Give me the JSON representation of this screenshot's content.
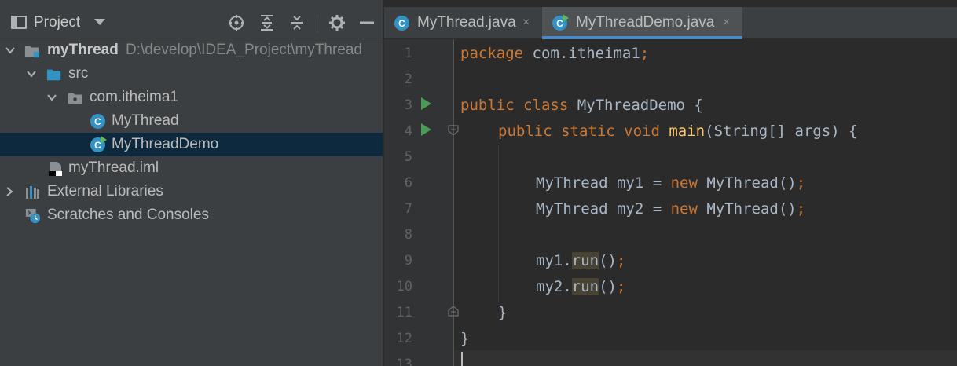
{
  "project_panel": {
    "title": "Project",
    "icons": [
      "locate-icon",
      "expand-all-icon",
      "collapse-all-icon",
      "gear-icon",
      "hide-icon"
    ],
    "tree": [
      {
        "label": "myThread",
        "path": "D:\\develop\\IDEA_Project\\myThread",
        "icon": "module-icon",
        "expanded": true
      },
      {
        "label": "src",
        "icon": "folder-icon",
        "expanded": true
      },
      {
        "label": "com.itheima1",
        "icon": "package-icon",
        "expanded": true
      },
      {
        "label": "MyThread",
        "icon": "class-icon"
      },
      {
        "label": "MyThreadDemo",
        "icon": "runnable-class-icon",
        "selected": true
      },
      {
        "label": "myThread.iml",
        "icon": "iml-file-icon"
      },
      {
        "label": "External Libraries",
        "icon": "libraries-icon",
        "expanded": false
      },
      {
        "label": "Scratches and Consoles",
        "icon": "scratches-icon"
      }
    ]
  },
  "tabs": [
    {
      "label": "MyThread.java",
      "close": "×",
      "active": false
    },
    {
      "label": "MyThreadDemo.java",
      "close": "×",
      "active": true
    }
  ],
  "editor": {
    "line_numbers": [
      "1",
      "2",
      "3",
      "4",
      "5",
      "6",
      "7",
      "8",
      "9",
      "10",
      "11",
      "12",
      "13"
    ],
    "lines": {
      "l1_kw": "package",
      "l1_rest": " com.itheima1",
      "l1_semi": ";",
      "l3_kw": "public class",
      "l3_rest": " MyThreadDemo {",
      "l4_kw": "public static void",
      "l4_fn": "main",
      "l4_rest": "(String[] args) {",
      "l6_a": "MyThread my1 = ",
      "l6_kw": "new",
      "l6_b": " MyThread()",
      "l6_semi": ";",
      "l7_a": "MyThread my2 = ",
      "l7_kw": "new",
      "l7_b": " MyThread()",
      "l7_semi": ";",
      "l9_a": "my1.",
      "l9_hl": "run",
      "l9_b": "()",
      "l9_semi": ";",
      "l10_a": "my2.",
      "l10_hl": "run",
      "l10_b": "()",
      "l10_semi": ";",
      "l11": "}",
      "l12": "}"
    }
  },
  "colors": {
    "keyword": "#cc7832",
    "function": "#ffc66d",
    "text": "#a9b7c6",
    "selection": "#0d293e",
    "tab_underline": "#4a88c7",
    "run_gutter": "#499c54",
    "class_icon": "#3592c4"
  }
}
